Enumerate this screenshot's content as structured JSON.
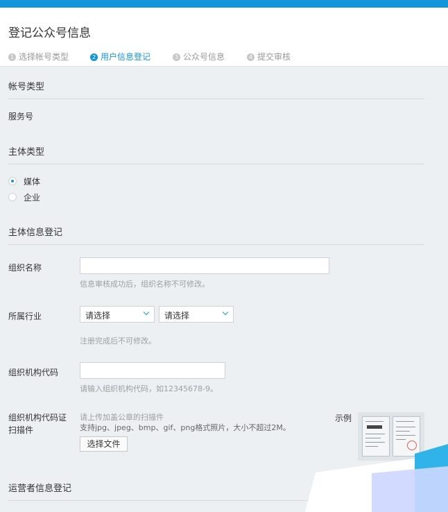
{
  "header": {
    "title": "登记公众号信息",
    "steps": [
      {
        "num": "1",
        "label": "选择帐号类型"
      },
      {
        "num": "2",
        "label": "用户信息登记"
      },
      {
        "num": "3",
        "label": "公众号信息"
      },
      {
        "num": "4",
        "label": "提交审核"
      }
    ]
  },
  "account_type": {
    "title": "帐号类型",
    "value": "服务号"
  },
  "subject_type": {
    "title": "主体类型",
    "options": [
      "媒体",
      "企业"
    ],
    "selected": "媒体"
  },
  "subject_info": {
    "title": "主体信息登记",
    "org_name": {
      "label": "组织名称",
      "value": "",
      "hint": "信息审核成功后，组织名称不可修改。"
    },
    "industry": {
      "label": "所属行业",
      "select1": "请选择",
      "select2": "请选择",
      "hint": "注册完成后不可修改。"
    },
    "org_code": {
      "label": "组织机构代码",
      "value": "",
      "hint": "请输入组织机构代码，如12345678-9。"
    },
    "org_scan": {
      "label_line1": "组织机构代码证",
      "label_line2": "扫描件",
      "hint1": "请上传加盖公章的扫描件",
      "hint2": "支持jpg、jpeg、bmp、gif、png格式照片，大小不超过2M。",
      "button": "选择文件",
      "example_label": "示例"
    }
  },
  "operator_info": {
    "title": "运营者信息登记"
  },
  "colors": {
    "accent": "#1296db",
    "background": "#edf0f3"
  }
}
